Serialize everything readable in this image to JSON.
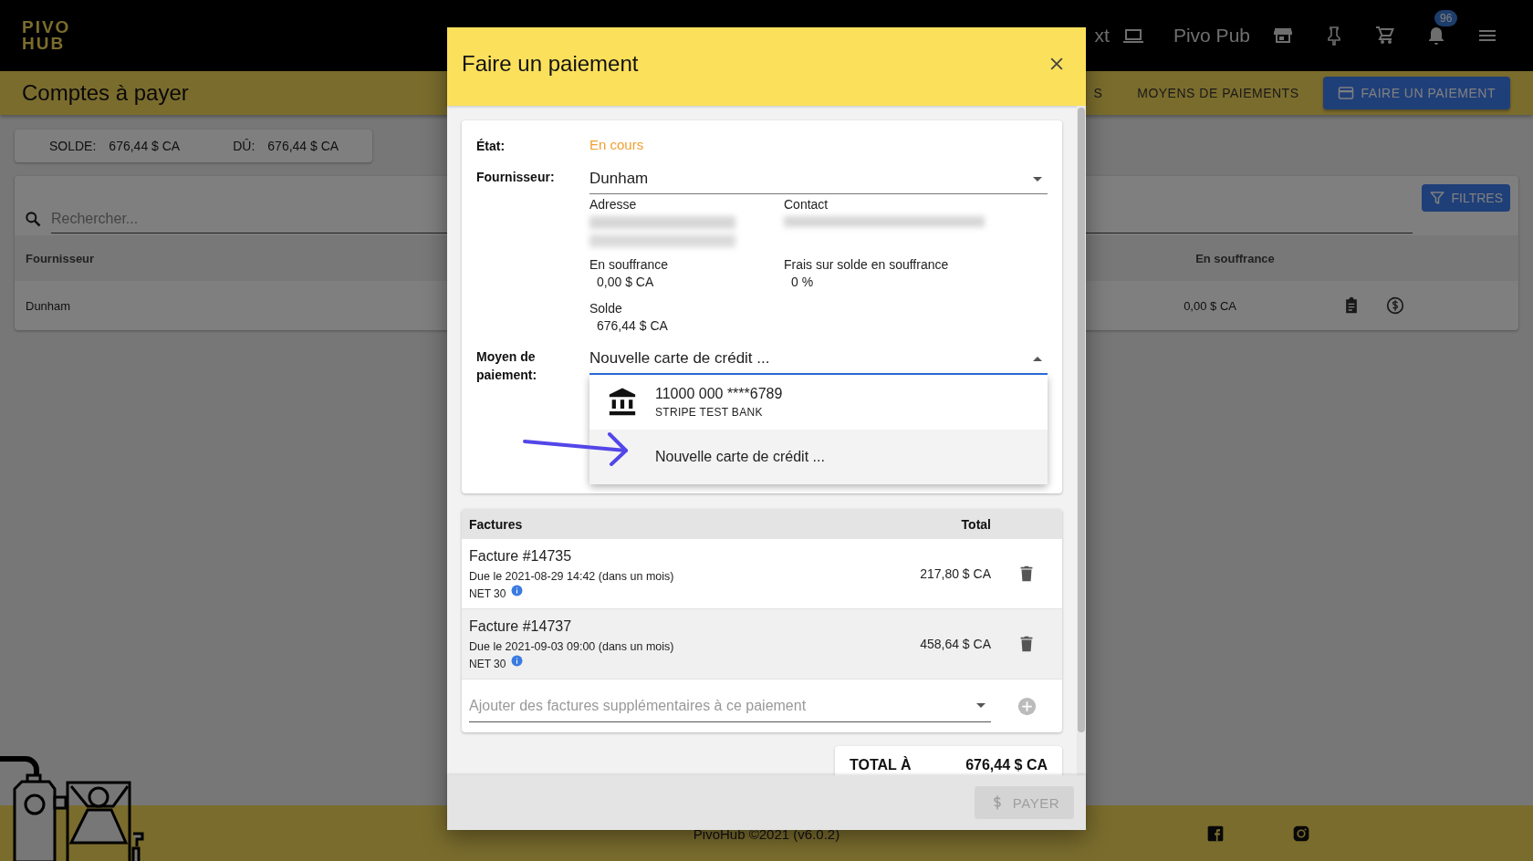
{
  "topbar": {
    "logo_lines": [
      "PIVO",
      "HUB"
    ],
    "partial_label": "xt",
    "account": "Pivo Pub",
    "notifications_badge": "96"
  },
  "page": {
    "title": "Comptes à payer",
    "tabs": [
      {
        "label": "S",
        "selected": false
      },
      {
        "label": "MOYENS DE PAIEMENTS",
        "selected": false
      }
    ],
    "primary_button": "FAIRE UN PAIEMENT",
    "balance": [
      {
        "label": "SOLDE:",
        "value": "676,44 $ CA"
      },
      {
        "label": "DÛ:",
        "value": "676,44 $ CA"
      }
    ],
    "search": {
      "placeholder": "Rechercher..."
    },
    "filters_button": "FILTRES",
    "table": {
      "columns": [
        "Fournisseur",
        "En souffrance"
      ],
      "rows": [
        {
          "cells": [
            "Dunham",
            "0,00 $ CA"
          ]
        }
      ]
    }
  },
  "footer": {
    "text": "PivoHub ©2021 (v6.0.2)"
  },
  "dialog": {
    "title": "Faire un paiement",
    "state_label": "État:",
    "state": "En cours",
    "supplier_label": "Fournisseur:",
    "supplier": "Dunham",
    "info": [
      {
        "label": "Adresse",
        "kind": "redacted"
      },
      {
        "label": "Contact",
        "kind": "redacted"
      },
      {
        "label": "En souffrance",
        "kind": "value",
        "value": "0,00 $ CA"
      },
      {
        "label": "Frais sur solde en souffrance",
        "kind": "value",
        "value": "0 %"
      },
      {
        "label": "Solde",
        "kind": "value",
        "value": "676,44 $ CA"
      }
    ],
    "method_label": "Moyen de paiement:",
    "method": {
      "value": "Nouvelle carte de crédit ...",
      "open": true,
      "options": [
        {
          "kind": "bank",
          "title": "11000 000 ****6789",
          "subtitle": "STRIPE TEST BANK",
          "selected": false
        },
        {
          "kind": "new",
          "title": "Nouvelle carte de crédit ...",
          "selected": true
        }
      ]
    },
    "invoices": {
      "columns": [
        "Factures",
        "Total"
      ],
      "rows": [
        {
          "title": "Facture #14735",
          "due": "Due le 2021-08-29 14:42 (dans un mois)",
          "terms": "NET 30",
          "total": "217,80 $ CA"
        },
        {
          "title": "Facture #14737",
          "due": "Due le 2021-09-03 09:00 (dans un mois)",
          "terms": "NET 30",
          "total": "458,64 $ CA"
        }
      ],
      "add_placeholder": "Ajouter des factures supplémentaires à ce paiement"
    },
    "total": {
      "label": "TOTAL À",
      "value": "676,44 $ CA"
    },
    "pay_button": {
      "label": "PAYER",
      "disabled": true
    }
  }
}
